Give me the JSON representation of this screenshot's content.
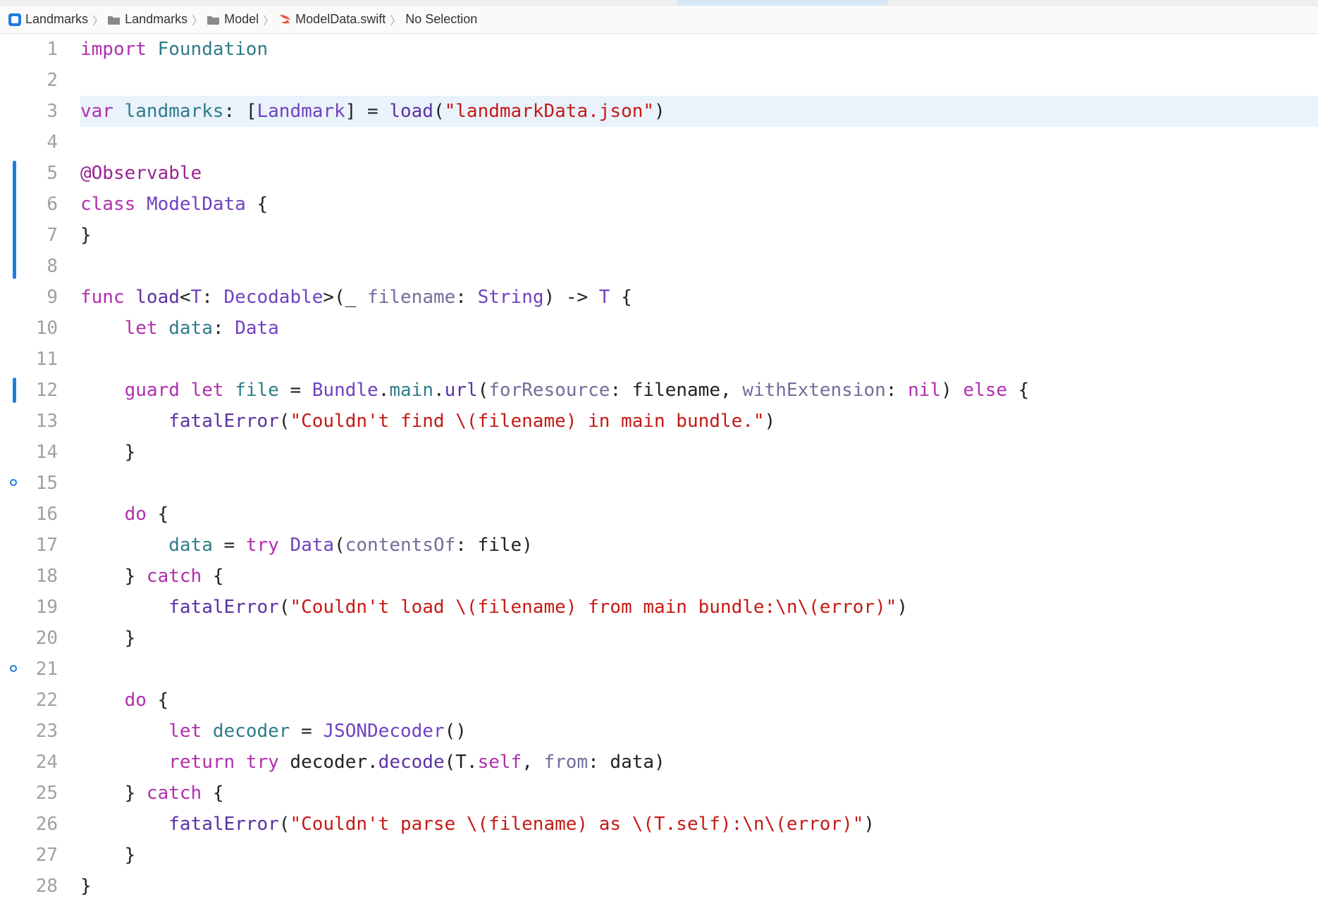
{
  "breadcrumb": {
    "items": [
      {
        "label": "Landmarks",
        "icon": "app-icon"
      },
      {
        "label": "Landmarks",
        "icon": "folder-icon"
      },
      {
        "label": "Model",
        "icon": "folder-icon"
      },
      {
        "label": "ModelData.swift",
        "icon": "swift-icon"
      },
      {
        "label": "No Selection",
        "icon": ""
      }
    ]
  },
  "filename": "ModelData.swift",
  "highlighted_line": 3,
  "change_bars": [
    {
      "start": 5,
      "end": 8
    },
    {
      "start": 12,
      "end": 12
    }
  ],
  "fold_markers": [
    15,
    21
  ],
  "code": [
    {
      "n": 1,
      "tokens": [
        [
          "kw",
          "import"
        ],
        [
          "punc",
          " "
        ],
        [
          "ident",
          "Foundation"
        ]
      ]
    },
    {
      "n": 2,
      "tokens": []
    },
    {
      "n": 3,
      "tokens": [
        [
          "kw",
          "var"
        ],
        [
          "punc",
          " "
        ],
        [
          "ident",
          "landmarks"
        ],
        [
          "punc",
          ": ["
        ],
        [
          "type",
          "Landmark"
        ],
        [
          "punc",
          "] = "
        ],
        [
          "func",
          "load"
        ],
        [
          "punc",
          "("
        ],
        [
          "str",
          "\"landmarkData.json\""
        ],
        [
          "punc",
          ")"
        ]
      ]
    },
    {
      "n": 4,
      "tokens": []
    },
    {
      "n": 5,
      "tokens": [
        [
          "annot",
          "@Observable"
        ]
      ]
    },
    {
      "n": 6,
      "tokens": [
        [
          "kw",
          "class"
        ],
        [
          "punc",
          " "
        ],
        [
          "type",
          "ModelData"
        ],
        [
          "punc",
          " {"
        ]
      ]
    },
    {
      "n": 7,
      "tokens": [
        [
          "punc",
          "}"
        ]
      ]
    },
    {
      "n": 8,
      "tokens": []
    },
    {
      "n": 9,
      "tokens": [
        [
          "kw",
          "func"
        ],
        [
          "punc",
          " "
        ],
        [
          "func",
          "load"
        ],
        [
          "punc",
          "<"
        ],
        [
          "type",
          "T"
        ],
        [
          "punc",
          ": "
        ],
        [
          "type",
          "Decodable"
        ],
        [
          "punc",
          ">(_ "
        ],
        [
          "param",
          "filename"
        ],
        [
          "punc",
          ": "
        ],
        [
          "type",
          "String"
        ],
        [
          "punc",
          ") -> "
        ],
        [
          "type",
          "T"
        ],
        [
          "punc",
          " {"
        ]
      ]
    },
    {
      "n": 10,
      "tokens": [
        [
          "punc",
          "    "
        ],
        [
          "kw",
          "let"
        ],
        [
          "punc",
          " "
        ],
        [
          "ident",
          "data"
        ],
        [
          "punc",
          ": "
        ],
        [
          "type",
          "Data"
        ]
      ]
    },
    {
      "n": 11,
      "tokens": []
    },
    {
      "n": 12,
      "tokens": [
        [
          "punc",
          "    "
        ],
        [
          "kw",
          "guard"
        ],
        [
          "punc",
          " "
        ],
        [
          "kw",
          "let"
        ],
        [
          "punc",
          " "
        ],
        [
          "ident",
          "file"
        ],
        [
          "punc",
          " = "
        ],
        [
          "type",
          "Bundle"
        ],
        [
          "punc",
          "."
        ],
        [
          "ident",
          "main"
        ],
        [
          "punc",
          "."
        ],
        [
          "func",
          "url"
        ],
        [
          "punc",
          "("
        ],
        [
          "param",
          "forResource"
        ],
        [
          "punc",
          ": filename, "
        ],
        [
          "param",
          "withExtension"
        ],
        [
          "punc",
          ": "
        ],
        [
          "kw",
          "nil"
        ],
        [
          "punc",
          ") "
        ],
        [
          "kw",
          "else"
        ],
        [
          "punc",
          " {"
        ]
      ]
    },
    {
      "n": 13,
      "tokens": [
        [
          "punc",
          "        "
        ],
        [
          "func",
          "fatalError"
        ],
        [
          "punc",
          "("
        ],
        [
          "str",
          "\"Couldn't find \\(filename) in main bundle.\""
        ],
        [
          "punc",
          ")"
        ]
      ]
    },
    {
      "n": 14,
      "tokens": [
        [
          "punc",
          "    }"
        ]
      ]
    },
    {
      "n": 15,
      "tokens": []
    },
    {
      "n": 16,
      "tokens": [
        [
          "punc",
          "    "
        ],
        [
          "kw",
          "do"
        ],
        [
          "punc",
          " {"
        ]
      ]
    },
    {
      "n": 17,
      "tokens": [
        [
          "punc",
          "        "
        ],
        [
          "ident",
          "data"
        ],
        [
          "punc",
          " = "
        ],
        [
          "kw",
          "try"
        ],
        [
          "punc",
          " "
        ],
        [
          "type",
          "Data"
        ],
        [
          "punc",
          "("
        ],
        [
          "param",
          "contentsOf"
        ],
        [
          "punc",
          ": file)"
        ]
      ]
    },
    {
      "n": 18,
      "tokens": [
        [
          "punc",
          "    } "
        ],
        [
          "kw",
          "catch"
        ],
        [
          "punc",
          " {"
        ]
      ]
    },
    {
      "n": 19,
      "tokens": [
        [
          "punc",
          "        "
        ],
        [
          "func",
          "fatalError"
        ],
        [
          "punc",
          "("
        ],
        [
          "str",
          "\"Couldn't load \\(filename) from main bundle:\\n\\(error)\""
        ],
        [
          "punc",
          ")"
        ]
      ]
    },
    {
      "n": 20,
      "tokens": [
        [
          "punc",
          "    }"
        ]
      ]
    },
    {
      "n": 21,
      "tokens": []
    },
    {
      "n": 22,
      "tokens": [
        [
          "punc",
          "    "
        ],
        [
          "kw",
          "do"
        ],
        [
          "punc",
          " {"
        ]
      ]
    },
    {
      "n": 23,
      "tokens": [
        [
          "punc",
          "        "
        ],
        [
          "kw",
          "let"
        ],
        [
          "punc",
          " "
        ],
        [
          "ident",
          "decoder"
        ],
        [
          "punc",
          " = "
        ],
        [
          "type",
          "JSONDecoder"
        ],
        [
          "punc",
          "()"
        ]
      ]
    },
    {
      "n": 24,
      "tokens": [
        [
          "punc",
          "        "
        ],
        [
          "kw",
          "return"
        ],
        [
          "punc",
          " "
        ],
        [
          "kw",
          "try"
        ],
        [
          "punc",
          " decoder."
        ],
        [
          "func",
          "decode"
        ],
        [
          "punc",
          "(T."
        ],
        [
          "kw",
          "self"
        ],
        [
          "punc",
          ", "
        ],
        [
          "param",
          "from"
        ],
        [
          "punc",
          ": data)"
        ]
      ]
    },
    {
      "n": 25,
      "tokens": [
        [
          "punc",
          "    } "
        ],
        [
          "kw",
          "catch"
        ],
        [
          "punc",
          " {"
        ]
      ]
    },
    {
      "n": 26,
      "tokens": [
        [
          "punc",
          "        "
        ],
        [
          "func",
          "fatalError"
        ],
        [
          "punc",
          "("
        ],
        [
          "str",
          "\"Couldn't parse \\(filename) as \\(T.self):\\n\\(error)\""
        ],
        [
          "punc",
          ")"
        ]
      ]
    },
    {
      "n": 27,
      "tokens": [
        [
          "punc",
          "    }"
        ]
      ]
    },
    {
      "n": 28,
      "tokens": [
        [
          "punc",
          "}"
        ]
      ]
    }
  ]
}
